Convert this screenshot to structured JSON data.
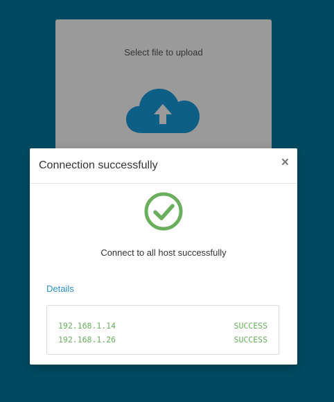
{
  "upload": {
    "title": "Select file to upload",
    "icon": "cloud-upload-icon",
    "icon_color": "#0e5f85"
  },
  "modal": {
    "title": "Connection successfully",
    "close_label": "×",
    "status_icon": "check-circle-icon",
    "status_color": "#6aae5e",
    "message": "Connect to all host successfully",
    "details_label": "Details",
    "hosts": [
      {
        "ip": "192.168.1.14",
        "status": "SUCCESS"
      },
      {
        "ip": "192.168.1.26",
        "status": "SUCCESS"
      }
    ]
  },
  "colors": {
    "background": "#004a61",
    "link": "#2a8fd6"
  }
}
